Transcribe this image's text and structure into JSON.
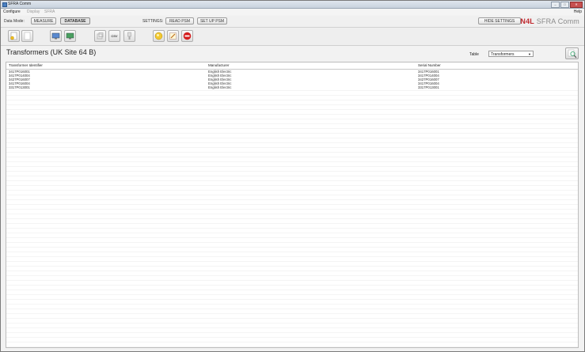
{
  "window": {
    "title": "SFRA Comm"
  },
  "menu": {
    "items": [
      "Configure",
      "Display",
      "SFRA"
    ],
    "help": "Help"
  },
  "mode": {
    "data_mode_label": "Data Mode:",
    "measure": "MEASURE",
    "database": "DATABASE",
    "settings_label": "SETTINGS:",
    "read_psm": "READ PSM",
    "setup_psm": "SET UP PSM",
    "hide_settings": "HIDE SETTINGS"
  },
  "brand": {
    "n4l": "N4L",
    "product": "SFRA Comm"
  },
  "toolbar": {
    "csv_label": "CSV"
  },
  "page": {
    "title": "Transformers (UK Site 64 B)",
    "table_label": "Table",
    "table_selected": "Transformers"
  },
  "grid": {
    "columns": [
      "Transformer Identifier",
      "Manufacturer",
      "Serial Number"
    ],
    "rows": [
      [
        "3417P016001",
        "English Electric",
        "3417P016001"
      ],
      [
        "3417P014004",
        "English Electric",
        "3417P014004"
      ],
      [
        "3427P016007",
        "English Electric",
        "3427P016007"
      ],
      [
        "3417P016004",
        "English Electric",
        "3417P016004"
      ],
      [
        "3317P013001",
        "English Electric",
        "3317P013001"
      ]
    ]
  },
  "colors": {
    "accent": "#c0282e",
    "stop": "#d42020",
    "ok": "#e8b820"
  }
}
